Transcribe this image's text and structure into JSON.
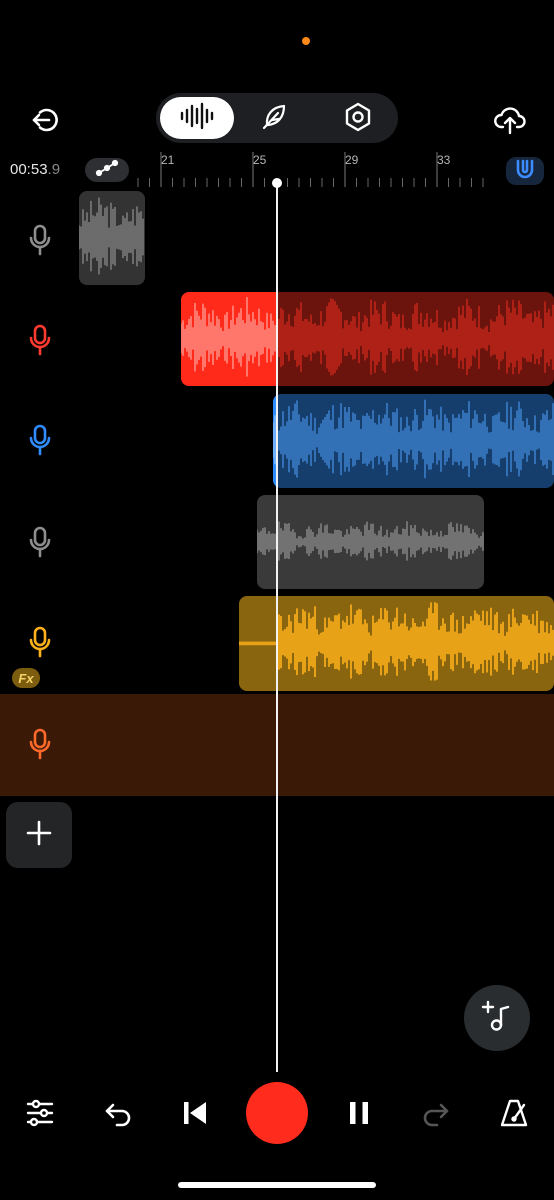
{
  "status": {
    "indicator_color": "#ff8a1a"
  },
  "toolbar": {
    "back_icon": "exit-arrow-icon",
    "modes": [
      "waveform-icon",
      "quill-icon",
      "hexagon-settings-icon"
    ],
    "active_mode": 0,
    "upload_icon": "cloud-upload-icon"
  },
  "timeline": {
    "time_main": "00:53",
    "time_frac": ".9",
    "ruler_labels": [
      "21",
      "25",
      "29",
      "33"
    ]
  },
  "tracks": [
    {
      "name": "track-1",
      "mic_color": "#8e8e8e",
      "clip_color": "#3a3a3a"
    },
    {
      "name": "track-2",
      "mic_color": "#ff3b30",
      "clip_color": "#ff2a1a"
    },
    {
      "name": "track-3",
      "mic_color": "#2f8bff",
      "clip_color": "#2d8cff"
    },
    {
      "name": "track-4",
      "mic_color": "#8e8e8e",
      "clip_color": "#3a3a3a"
    },
    {
      "name": "track-5",
      "mic_color": "#ffb11a",
      "clip_color": "#e8a213",
      "fx_label": "Fx"
    },
    {
      "name": "track-6",
      "mic_color": "#ff6a2a",
      "clip_color": "#3a1906"
    }
  ],
  "transport": {
    "mixer_icon": "sliders-icon",
    "undo_icon": "undo-icon",
    "rewind_icon": "skip-to-start-icon",
    "record_color": "#ff2b1c",
    "pause_icon": "pause-icon",
    "redo_icon": "redo-icon",
    "metronome_icon": "metronome-icon"
  }
}
